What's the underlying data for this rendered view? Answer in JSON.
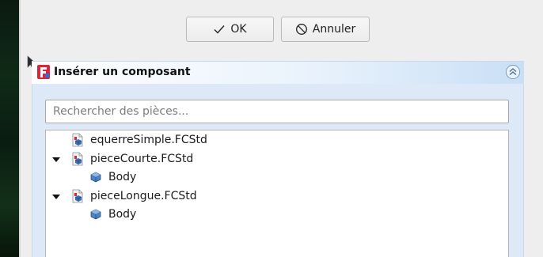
{
  "dialog": {
    "ok_label": "OK",
    "cancel_label": "Annuler"
  },
  "task_panel": {
    "title": "Insérer un composant",
    "search": {
      "placeholder": "Rechercher des pièces...",
      "value": ""
    },
    "tree": {
      "items": [
        {
          "label": "equerreSimple.FCStd",
          "type": "file",
          "expanded": false
        },
        {
          "label": "pieceCourte.FCStd",
          "type": "file",
          "expanded": true
        },
        {
          "label": "Body",
          "type": "body"
        },
        {
          "label": "pieceLongue.FCStd",
          "type": "file",
          "expanded": true
        },
        {
          "label": "Body",
          "type": "body"
        }
      ]
    }
  },
  "icons": {
    "ok": "checkmark-icon",
    "cancel": "circle-slash-icon",
    "logo": "freecad-logo-icon",
    "collapse": "double-chevron-up-icon",
    "file": "fcstd-file-icon",
    "body": "body-cube-icon",
    "expand": "triangle-down-icon"
  },
  "colors": {
    "header_gradient_end": "#c9dff6",
    "panel_body": "#dde9f7",
    "logo_red": "#d7263d",
    "logo_blue": "#2f6fd1"
  }
}
